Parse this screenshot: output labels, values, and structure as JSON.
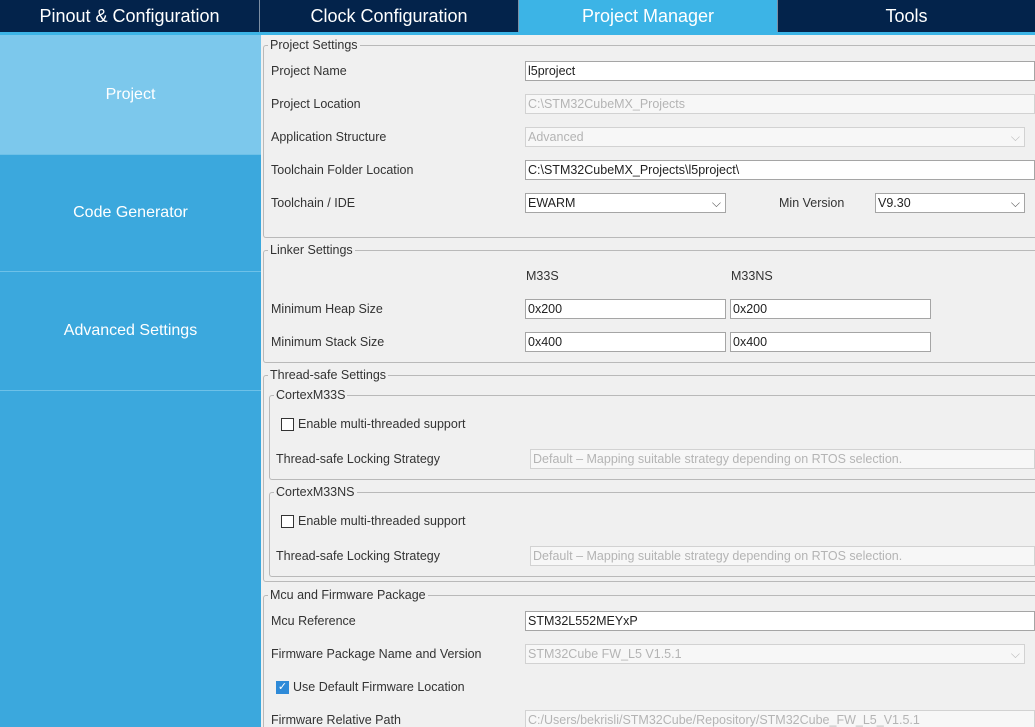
{
  "tabs": [
    {
      "label": "Pinout & Configuration"
    },
    {
      "label": "Clock Configuration"
    },
    {
      "label": "Project Manager"
    },
    {
      "label": "Tools"
    }
  ],
  "sidebar": {
    "items": [
      {
        "label": "Project"
      },
      {
        "label": "Code Generator"
      },
      {
        "label": "Advanced Settings"
      }
    ]
  },
  "project_settings": {
    "legend": "Project Settings",
    "name_label": "Project Name",
    "name_value": "l5project",
    "location_label": "Project Location",
    "location_value": "C:\\STM32CubeMX_Projects",
    "structure_label": "Application Structure",
    "structure_value": "Advanced",
    "toolchain_folder_label": "Toolchain Folder Location",
    "toolchain_folder_value": "C:\\STM32CubeMX_Projects\\l5project\\",
    "toolchain_label": "Toolchain / IDE",
    "toolchain_value": "EWARM",
    "min_version_label": "Min Version",
    "min_version_value": "V9.30"
  },
  "linker_settings": {
    "legend": "Linker Settings",
    "col1": "M33S",
    "col2": "M33NS",
    "heap_label": "Minimum Heap Size",
    "heap_s": "0x200",
    "heap_ns": "0x200",
    "stack_label": "Minimum Stack Size",
    "stack_s": "0x400",
    "stack_ns": "0x400"
  },
  "thread_safe": {
    "legend": "Thread-safe Settings",
    "cortex_s": {
      "legend": "CortexM33S",
      "enable_label": "Enable multi-threaded support",
      "strategy_label": "Thread-safe Locking Strategy",
      "strategy_value": "Default – Mapping suitable strategy depending on RTOS selection."
    },
    "cortex_ns": {
      "legend": "CortexM33NS",
      "enable_label": "Enable multi-threaded support",
      "strategy_label": "Thread-safe Locking Strategy",
      "strategy_value": "Default – Mapping suitable strategy depending on RTOS selection."
    }
  },
  "mcu_fw": {
    "legend": "Mcu and Firmware Package",
    "mcu_ref_label": "Mcu Reference",
    "mcu_ref_value": "STM32L552MEYxP",
    "fw_name_label": "Firmware Package Name and Version",
    "fw_name_value": "STM32Cube FW_L5 V1.5.1",
    "use_default_label": "Use Default Firmware Location",
    "use_default_checked": true,
    "fw_path_label": "Firmware Relative Path",
    "fw_path_value": "C:/Users/bekrisli/STM32Cube/Repository/STM32Cube_FW_L5_V1.5.1"
  },
  "icons": {
    "dropdown": "chevron-down-icon",
    "check": "checkmark-icon"
  },
  "colors": {
    "topbar": "#03234b",
    "accent": "#3cb4e6",
    "sidebar": "#3ba8dd",
    "sidebar_active": "#7cc8ec"
  }
}
